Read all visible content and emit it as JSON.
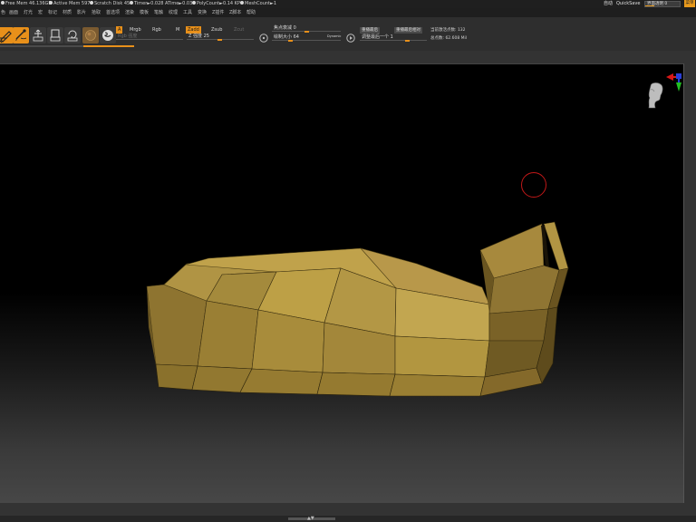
{
  "status": {
    "free_mem": "Free Mem 46.136GB",
    "active_mem": "Active Mem 5974",
    "scratch_disk": "Scratch Disk 45",
    "timer": "Timer►0.028 ATime►0.034",
    "poly_count": "PolyCount►0.14 KP",
    "mesh_count": "MeshCount►1",
    "autosave": "自动",
    "quicksave": "QuickSave",
    "transparency_field": "界面透明 0",
    "menu_button": "菜单"
  },
  "menus": [
    "色",
    "画面",
    "灯光",
    "宏",
    "标记",
    "材质",
    "影片",
    "拾取",
    "首选项",
    "渲染",
    "模板",
    "笔触",
    "纹理",
    "工具",
    "变换",
    "Z插件",
    "Z脚本",
    "帮助"
  ],
  "toolbar": {
    "tools": [
      "编辑",
      "绘制",
      "移动",
      "缩放",
      "旋转"
    ],
    "modes": [
      "A",
      "Mrgb",
      "Rgb",
      "M",
      "Zadd",
      "Zsub",
      "Zcut"
    ],
    "rgb_intensity": "Rgb 强度",
    "z_intensity": "Z 强度 25",
    "focal_shift": "焦点衰减 0",
    "draw_size": "绘制大小 64",
    "dynamic": "Dynamic",
    "replay_last": "重播最后",
    "replay_last_rel": "重播最后相对",
    "adjust_last": "调整最后一个 1",
    "active_points": "当前激活点数: 132",
    "total_points": "总点数: 62.608 Mil"
  },
  "colors": {
    "accent": "#e8901a",
    "mesh": "#b4963c",
    "brush_cursor": "#c01818"
  }
}
